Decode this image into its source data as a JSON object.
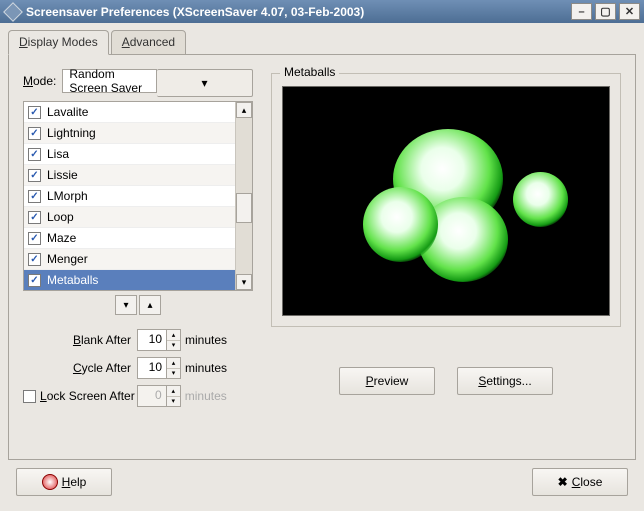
{
  "window": {
    "title": "Screensaver Preferences  (XScreenSaver 4.07, 03-Feb-2003)"
  },
  "tabs": {
    "display": "Display Modes",
    "advanced": "Advanced"
  },
  "mode": {
    "label": "Mode:",
    "value": "Random Screen Saver"
  },
  "screensavers": [
    {
      "name": "Lavalite",
      "checked": true,
      "selected": false
    },
    {
      "name": "Lightning",
      "checked": true,
      "selected": false
    },
    {
      "name": "Lisa",
      "checked": true,
      "selected": false
    },
    {
      "name": "Lissie",
      "checked": true,
      "selected": false
    },
    {
      "name": "LMorph",
      "checked": true,
      "selected": false
    },
    {
      "name": "Loop",
      "checked": true,
      "selected": false
    },
    {
      "name": "Maze",
      "checked": true,
      "selected": false
    },
    {
      "name": "Menger",
      "checked": true,
      "selected": false
    },
    {
      "name": "Metaballs",
      "checked": true,
      "selected": true
    }
  ],
  "timing": {
    "blank_label": "Blank After",
    "blank_value": "10",
    "cycle_label": "Cycle After",
    "cycle_value": "10",
    "lock_label": "Lock Screen After",
    "lock_value": "0",
    "unit": "minutes"
  },
  "preview": {
    "group_label": "Metaballs",
    "preview_btn": "Preview",
    "settings_btn": "Settings..."
  },
  "footer": {
    "help": "Help",
    "close": "Close"
  }
}
